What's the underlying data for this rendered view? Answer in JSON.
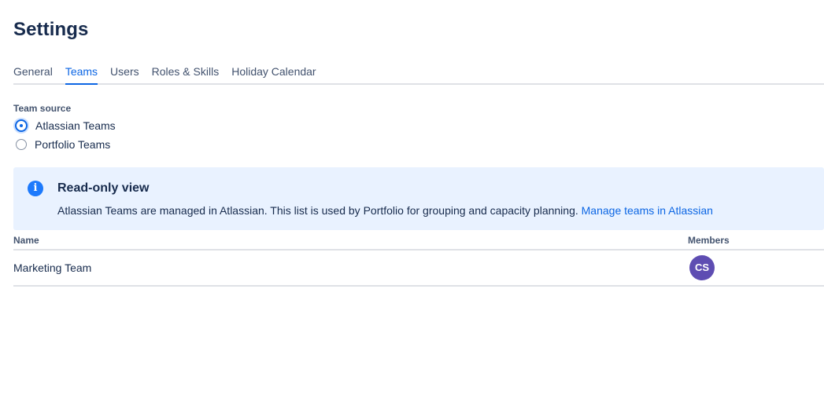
{
  "page": {
    "title": "Settings"
  },
  "tabs": [
    {
      "label": "General",
      "active": false
    },
    {
      "label": "Teams",
      "active": true
    },
    {
      "label": "Users",
      "active": false
    },
    {
      "label": "Roles & Skills",
      "active": false
    },
    {
      "label": "Holiday Calendar",
      "active": false
    }
  ],
  "team_source": {
    "label": "Team source",
    "options": [
      {
        "label": "Atlassian Teams",
        "selected": true
      },
      {
        "label": "Portfolio Teams",
        "selected": false
      }
    ]
  },
  "banner": {
    "icon": "info-icon",
    "title": "Read-only view",
    "text": "Atlassian Teams are managed in Atlassian. This list is used by Portfolio for grouping and capacity planning. ",
    "link_label": "Manage teams in Atlassian",
    "color": "#e9f2ff"
  },
  "table": {
    "headers": {
      "name": "Name",
      "members": "Members"
    },
    "rows": [
      {
        "name": "Marketing Team",
        "members": [
          {
            "initials": "CS",
            "color": "#5e4db2"
          }
        ]
      }
    ]
  },
  "colors": {
    "accent": "#0c66e4",
    "text": "#172b4d"
  }
}
